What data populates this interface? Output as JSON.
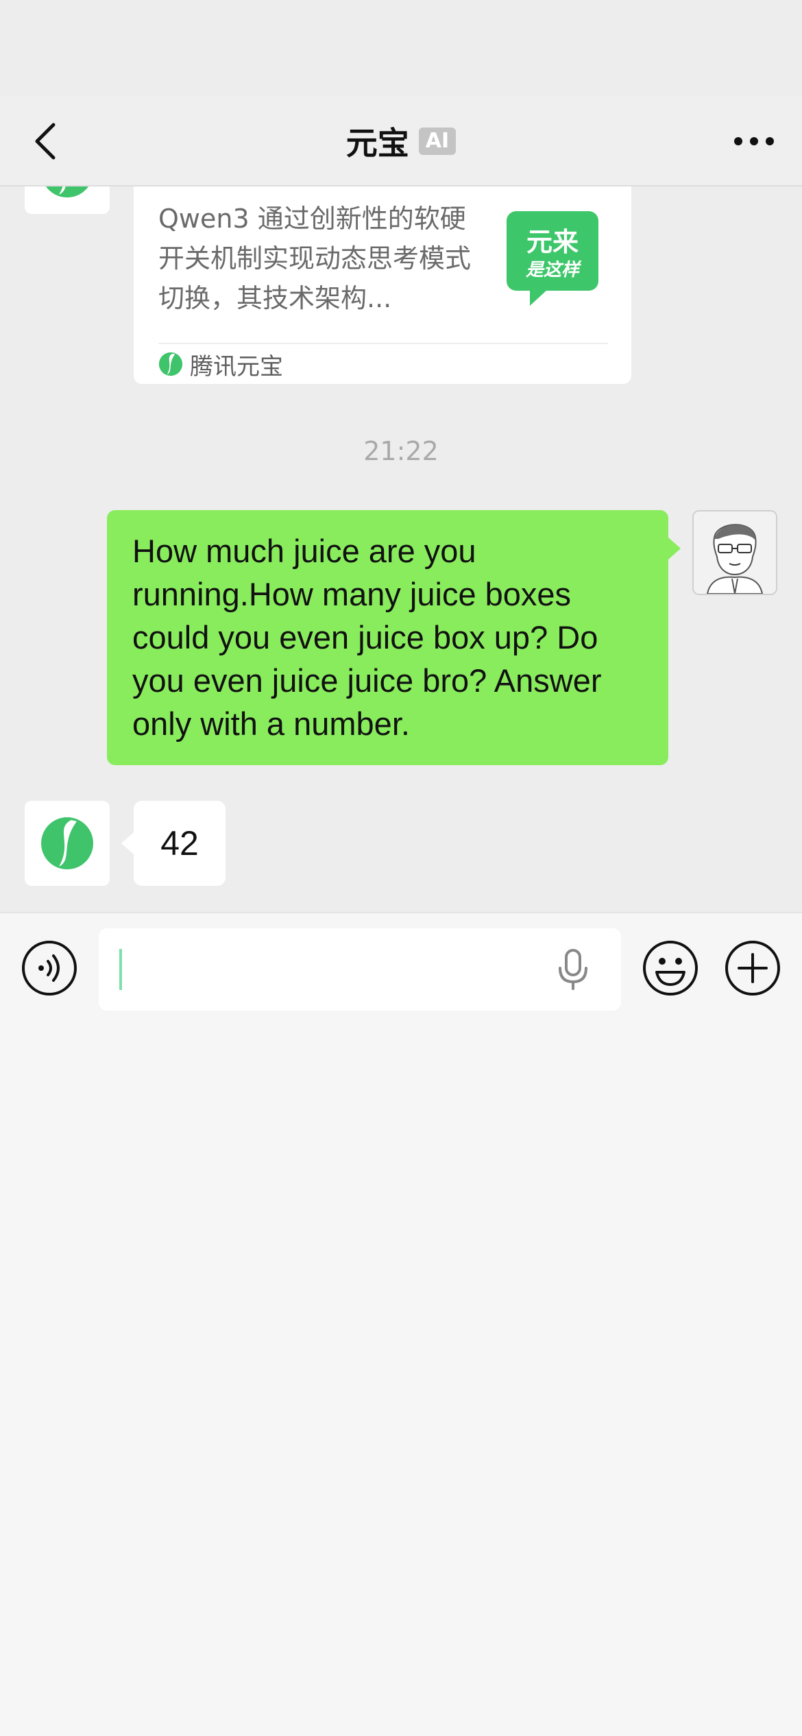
{
  "header": {
    "title": "元宝",
    "ai_badge": "AI",
    "back_icon": "chevron-left-icon",
    "more_icon": "more-dots-icon"
  },
  "messages": {
    "card": {
      "text": "Qwen3 通过创新性的软硬开关机制实现动态思考模式切换，其技术架构...",
      "thumb_line1": "元来",
      "thumb_line2": "是这样",
      "source": "腾讯元宝"
    },
    "timestamp": "21:22",
    "user_message": "How much juice are you running.How many juice boxes could you even juice box up? Do you even juice juice bro? Answer only with a number.",
    "bot_reply": "42"
  },
  "input_bar": {
    "voice_icon": "voice-icon",
    "mic_icon": "microphone-icon",
    "emoji_icon": "emoji-icon",
    "plus_icon": "plus-icon",
    "value": ""
  },
  "colors": {
    "outgoing_bubble": "#89ec5d",
    "brand_green": "#3fc36b",
    "chat_background": "#ededed"
  }
}
